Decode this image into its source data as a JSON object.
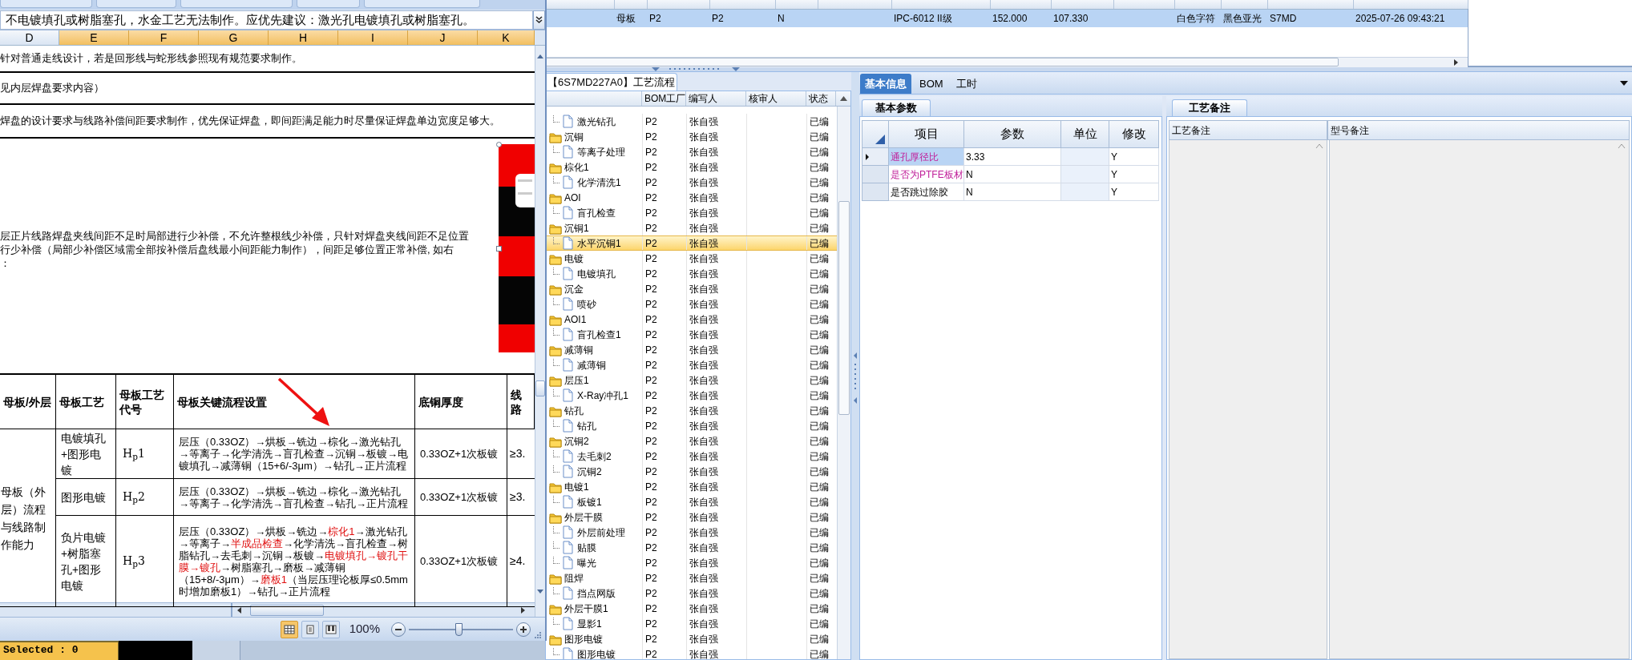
{
  "excel": {
    "formula_bar": "不电镀填孔或树脂塞孔，水金工艺无法制作。应优先建议：激光孔电镀填孔或树脂塞孔。",
    "columns": [
      {
        "label": "D",
        "selected": false
      },
      {
        "label": "E",
        "selected": true
      },
      {
        "label": "F",
        "selected": true
      },
      {
        "label": "G",
        "selected": true
      },
      {
        "label": "H",
        "selected": true
      },
      {
        "label": "I",
        "selected": true
      },
      {
        "label": "J",
        "selected": true
      },
      {
        "label": "K",
        "selected": true
      }
    ],
    "notes": [
      "针对普通走线设计，若是回形线与蛇形线参照现有规范要求制作。",
      "见内层焊盘要求内容）",
      "焊盘的设计要求与线路补偿间距要求制作，优先保证焊盘，即间距满足能力时尽量保证焊盘单边宽度足够大。"
    ],
    "paragraph": [
      "层正片线路焊盘夹线间距不足时局部进行少补偿，不允许整根线少补偿，只针对焊盘夹线间距不足位置",
      "行少补偿（局部少补偿区域需全部按补偿后盘线最小间距能力制作），间距足够位置正常补偿, 如右",
      "："
    ],
    "table": {
      "columns": [
        "母板/外层",
        "母板工艺",
        "母板工艺代号",
        "母板关键流程设置",
        "底铜厚度",
        "线路"
      ],
      "group_label": "母板（外层）流程与线路制作能力",
      "rows": [
        {
          "process": "电镀填孔+图形电镀",
          "code": "H$_{p}$1",
          "flow": "层压（0.33OZ）→烘板→铣边→棕化→激光钻孔→等离子→化学清洗→盲孔检查→沉铜→板镀→电镀填孔→减薄铜（15+6/-3μm）→钻孔→正片流程",
          "copper": "0.33OZ+1次板镀",
          "line": "≥3."
        },
        {
          "process": "图形电镀",
          "code": "H$_{p}$2",
          "flow": "层压（0.33OZ）→烘板→铣边→棕化→激光钻孔→等离子→化学清洗→盲孔检查→钻孔→正片流程",
          "copper": "0.33OZ+1次板镀",
          "line": "≥3."
        },
        {
          "process": "负片电镀+树脂塞孔+图形电镀",
          "code": "H$_{p}$3",
          "flow": "层压（0.33OZ）→烘板→铣边→**棕化1**→激光钻孔→等离子→**半成品检查**→化学清洗→盲孔检查→树脂钻孔→去毛刺→沉铜→板镀→**电镀填孔→镀孔干膜→镀孔**→树脂塞孔→磨板→减薄铜（15+8/-3μm）→**磨板1**（当层压理论板厚≤0.5mm时增加磨板1）→钻孔→正片流程",
          "copper": "0.33OZ+1次板镀",
          "line": "≥4."
        }
      ]
    },
    "zoom": "100%",
    "zoom_slider": {
      "level": 0.48
    }
  },
  "status_strip": {
    "selected_label": "Selected : 0"
  },
  "top_grid": {
    "row": {
      "selected": true,
      "cells": [
        "母板",
        "P2",
        "P2",
        "N",
        "IPC-6012 II级",
        "152.000",
        "107.330",
        "白色字符",
        "黑色亚光",
        "S7MD",
        "2025-07-26 09:43:21"
      ]
    }
  },
  "tree": {
    "title": "【6S7MD227A0】工艺流程",
    "columns": [
      "BOM工厂",
      "编写人",
      "核审人",
      "状态"
    ],
    "items": [
      {
        "kind": "file",
        "label": "激光钻孔",
        "bom": "P2",
        "writer": "张自强",
        "status": "已编",
        "selected": false
      },
      {
        "kind": "folder",
        "label": "沉铜",
        "bom": "P2",
        "writer": "张自强",
        "status": "已编",
        "selected": false,
        "children": [
          {
            "kind": "file",
            "label": "等离子处理",
            "bom": "P2",
            "writer": "张自强",
            "status": "已编",
            "selected": false
          }
        ]
      },
      {
        "kind": "folder",
        "label": "棕化1",
        "bom": "P2",
        "writer": "张自强",
        "status": "已编",
        "selected": false,
        "children": [
          {
            "kind": "file",
            "label": "化学清洗1",
            "bom": "P2",
            "writer": "张自强",
            "status": "已编",
            "selected": false
          }
        ]
      },
      {
        "kind": "folder",
        "label": "AOI",
        "bom": "P2",
        "writer": "张自强",
        "status": "已编",
        "selected": false,
        "children": [
          {
            "kind": "file",
            "label": "盲孔检查",
            "bom": "P2",
            "writer": "张自强",
            "status": "已编",
            "selected": false
          }
        ]
      },
      {
        "kind": "folder",
        "label": "沉铜1",
        "bom": "P2",
        "writer": "张自强",
        "status": "已编",
        "selected": false,
        "children": [
          {
            "kind": "file",
            "label": "水平沉铜1",
            "bom": "P2",
            "writer": "张自强",
            "status": "已编",
            "selected": true
          }
        ]
      },
      {
        "kind": "folder",
        "label": "电镀",
        "bom": "P2",
        "writer": "张自强",
        "status": "已编",
        "selected": false,
        "children": [
          {
            "kind": "file",
            "label": "电镀填孔",
            "bom": "P2",
            "writer": "张自强",
            "status": "已编",
            "selected": false
          }
        ]
      },
      {
        "kind": "folder",
        "label": "沉金",
        "bom": "P2",
        "writer": "张自强",
        "status": "已编",
        "selected": false,
        "children": [
          {
            "kind": "file",
            "label": "喷砂",
            "bom": "P2",
            "writer": "张自强",
            "status": "已编",
            "selected": false
          }
        ]
      },
      {
        "kind": "folder",
        "label": "AOI1",
        "bom": "P2",
        "writer": "张自强",
        "status": "已编",
        "selected": false,
        "children": [
          {
            "kind": "file",
            "label": "盲孔检查1",
            "bom": "P2",
            "writer": "张自强",
            "status": "已编",
            "selected": false
          }
        ]
      },
      {
        "kind": "folder",
        "label": "减薄铜",
        "bom": "P2",
        "writer": "张自强",
        "status": "已编",
        "selected": false,
        "children": [
          {
            "kind": "file",
            "label": "减薄铜",
            "bom": "P2",
            "writer": "张自强",
            "status": "已编",
            "selected": false
          }
        ]
      },
      {
        "kind": "folder",
        "label": "层压1",
        "bom": "P2",
        "writer": "张自强",
        "status": "已编",
        "selected": false,
        "children": [
          {
            "kind": "file",
            "label": "X-Ray冲孔1",
            "bom": "P2",
            "writer": "张自强",
            "status": "已编",
            "selected": false
          }
        ]
      },
      {
        "kind": "folder",
        "label": "钻孔",
        "bom": "P2",
        "writer": "张自强",
        "status": "已编",
        "selected": false,
        "children": [
          {
            "kind": "file",
            "label": "钻孔",
            "bom": "P2",
            "writer": "张自强",
            "status": "已编",
            "selected": false
          }
        ]
      },
      {
        "kind": "folder",
        "label": "沉铜2",
        "bom": "P2",
        "writer": "张自强",
        "status": "已编",
        "selected": false,
        "children": [
          {
            "kind": "file",
            "label": "去毛刺2",
            "bom": "P2",
            "writer": "张自强",
            "status": "已编",
            "selected": false
          },
          {
            "kind": "file",
            "label": "沉铜2",
            "bom": "P2",
            "writer": "张自强",
            "status": "已编",
            "selected": false
          }
        ]
      },
      {
        "kind": "folder",
        "label": "电镀1",
        "bom": "P2",
        "writer": "张自强",
        "status": "已编",
        "selected": false,
        "children": [
          {
            "kind": "file",
            "label": "板镀1",
            "bom": "P2",
            "writer": "张自强",
            "status": "已编",
            "selected": false
          }
        ]
      },
      {
        "kind": "folder",
        "label": "外层干膜",
        "bom": "P2",
        "writer": "张自强",
        "status": "已编",
        "selected": false,
        "children": [
          {
            "kind": "file",
            "label": "外层前处理",
            "bom": "P2",
            "writer": "张自强",
            "status": "已编",
            "selected": false
          },
          {
            "kind": "file",
            "label": "贴膜",
            "bom": "P2",
            "writer": "张自强",
            "status": "已编",
            "selected": false
          },
          {
            "kind": "file",
            "label": "曝光",
            "bom": "P2",
            "writer": "张自强",
            "status": "已编",
            "selected": false
          }
        ]
      },
      {
        "kind": "folder",
        "label": "阻焊",
        "bom": "P2",
        "writer": "张自强",
        "status": "已编",
        "selected": false,
        "children": [
          {
            "kind": "file",
            "label": "挡点网版",
            "bom": "P2",
            "writer": "张自强",
            "status": "已编",
            "selected": false
          }
        ]
      },
      {
        "kind": "folder",
        "label": "外层干膜1",
        "bom": "P2",
        "writer": "张自强",
        "status": "已编",
        "selected": false,
        "children": [
          {
            "kind": "file",
            "label": "显影1",
            "bom": "P2",
            "writer": "张自强",
            "status": "已编",
            "selected": false
          }
        ]
      },
      {
        "kind": "folder",
        "label": "图形电镀",
        "bom": "P2",
        "writer": "张自强",
        "status": "已编",
        "selected": false,
        "children": [
          {
            "kind": "file",
            "label": "图形电镀",
            "bom": "P2",
            "writer": "张自强",
            "status": "已编",
            "selected": false
          }
        ]
      }
    ]
  },
  "tabs": [
    {
      "label": "基本信息",
      "selected": true
    },
    {
      "label": "BOM",
      "selected": false
    },
    {
      "label": "工时",
      "selected": false
    }
  ],
  "basic_params": {
    "tab": "基本参数",
    "columns": [
      "项目",
      "参数",
      "单位",
      "修改"
    ],
    "rows": [
      {
        "item": "通孔厚径比",
        "value": "3.33",
        "modified": "Y",
        "required": true,
        "selected": true
      },
      {
        "item": "是否为PTFE板材",
        "value": "N",
        "modified": "Y",
        "required": true,
        "selected": false
      },
      {
        "item": "是否跳过除胶",
        "value": "N",
        "modified": "Y",
        "required": false,
        "selected": false
      }
    ]
  },
  "remarks": {
    "tab": "工艺备注",
    "columns": [
      "工艺备注",
      "型号备注"
    ]
  }
}
